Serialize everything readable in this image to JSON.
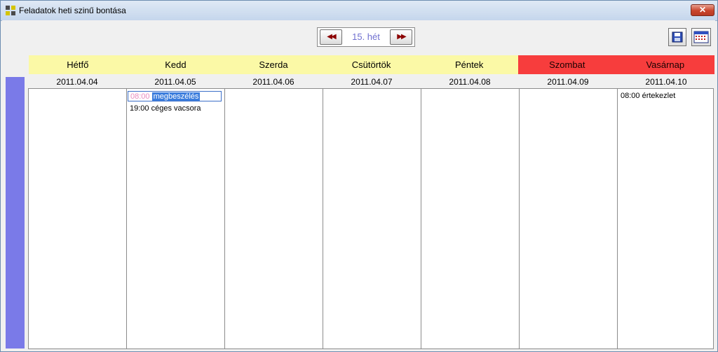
{
  "window": {
    "title": "Feladatok heti szinű bontása",
    "close_label": "✕"
  },
  "navigator": {
    "prev_label": "◀◀",
    "week_label": "15. hét",
    "next_label": "▶▶"
  },
  "toolbar": {
    "save_icon": "save-icon",
    "calendar_icon": "calendar-icon"
  },
  "colors": {
    "weekday_header": "#fbf9a6",
    "weekend_header": "#f73d3d",
    "left_strip": "#7a7ae8",
    "selection": "#3b7ddd"
  },
  "days": [
    {
      "name": "Hétfő",
      "date": "2011.04.04",
      "weekend": false,
      "events": []
    },
    {
      "name": "Kedd",
      "date": "2011.04.05",
      "weekend": false,
      "events": [
        {
          "time": "08:00",
          "title": "megbeszélés",
          "selected": true
        },
        {
          "time": "19:00",
          "title": "céges vacsora",
          "selected": false
        }
      ]
    },
    {
      "name": "Szerda",
      "date": "2011.04.06",
      "weekend": false,
      "events": []
    },
    {
      "name": "Csütörtök",
      "date": "2011.04.07",
      "weekend": false,
      "events": []
    },
    {
      "name": "Péntek",
      "date": "2011.04.08",
      "weekend": false,
      "events": []
    },
    {
      "name": "Szombat",
      "date": "2011.04.09",
      "weekend": true,
      "events": []
    },
    {
      "name": "Vasárnap",
      "date": "2011.04.10",
      "weekend": true,
      "events": [
        {
          "time": "08:00",
          "title": "értekezlet",
          "selected": false
        }
      ]
    }
  ]
}
